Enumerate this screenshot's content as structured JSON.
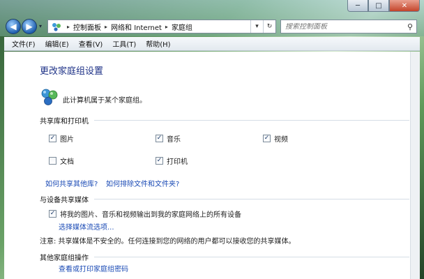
{
  "window": {
    "controls": {
      "minimize": "─",
      "maximize": "□",
      "close": "✕"
    }
  },
  "nav": {
    "back_icon": "back-arrow-icon",
    "forward_icon": "forward-arrow-icon",
    "back_glyph": "◀",
    "forward_glyph": "▶",
    "dropdown_glyph": "▾"
  },
  "address": {
    "breadcrumbs": [
      "控制面板",
      "网络和 Internet",
      "家庭组"
    ],
    "separator": "▸",
    "dropdown_glyph": "▾",
    "refresh_glyph": "↻"
  },
  "search": {
    "placeholder": "搜索控制面板",
    "icon_glyph": "⚲"
  },
  "menu": {
    "items": [
      "文件(F)",
      "编辑(E)",
      "查看(V)",
      "工具(T)",
      "帮助(H)"
    ]
  },
  "main": {
    "title": "更改家庭组设置",
    "membership_text": "此计算机属于某个家庭组。",
    "libraries": {
      "header": "共享库和打印机",
      "items": [
        {
          "label": "图片",
          "checked": true
        },
        {
          "label": "音乐",
          "checked": true
        },
        {
          "label": "视频",
          "checked": true
        },
        {
          "label": "文档",
          "checked": false
        },
        {
          "label": "打印机",
          "checked": true
        }
      ],
      "links": [
        "如何共享其他库?",
        "如何排除文件和文件夹?"
      ]
    },
    "media": {
      "header": "与设备共享媒体",
      "stream_checkbox": {
        "label": "将我的图片、音乐和视频输出到我的家庭网络上的所有设备",
        "checked": true
      },
      "link": "选择媒体流选项...",
      "note": "注意: 共享媒体是不安全的。任何连接到您的网络的用户都可以接收您的共享媒体。"
    },
    "other": {
      "header": "其他家庭组操作",
      "links": [
        "查看或打印家庭组密码"
      ]
    }
  },
  "colors": {
    "title_blue": "#1e3287",
    "link_blue": "#1a4ab5"
  }
}
